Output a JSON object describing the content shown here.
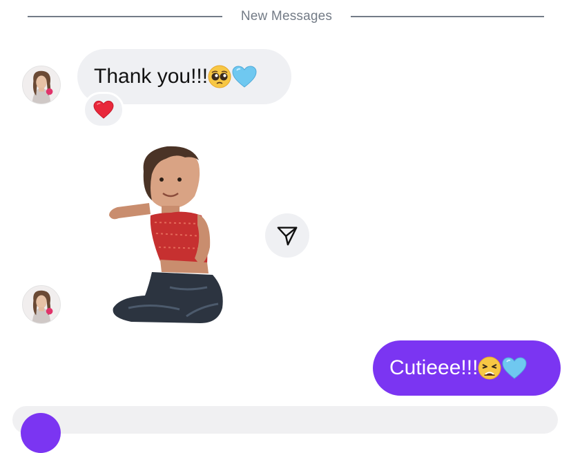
{
  "divider": {
    "label": "New Messages"
  },
  "messages": [
    {
      "id": "m1",
      "direction": "incoming",
      "text": "Thank you!!! ",
      "emojis": [
        "pleading-face-emoji",
        "blue-heart-emoji"
      ],
      "reaction": "red-heart-emoji"
    },
    {
      "id": "m2",
      "direction": "incoming",
      "type": "sticker",
      "sticker": "toddler-photo-sticker",
      "action_icon": "share-send-icon"
    },
    {
      "id": "m3",
      "direction": "outgoing",
      "text": "Cutieee!!! ",
      "emojis": [
        "weary-face-emoji",
        "blue-heart-emoji"
      ]
    }
  ],
  "colors": {
    "incoming_bubble": "#eff0f3",
    "outgoing_bubble": "#7b35f2",
    "divider": "#737b86",
    "text": "#121212"
  }
}
